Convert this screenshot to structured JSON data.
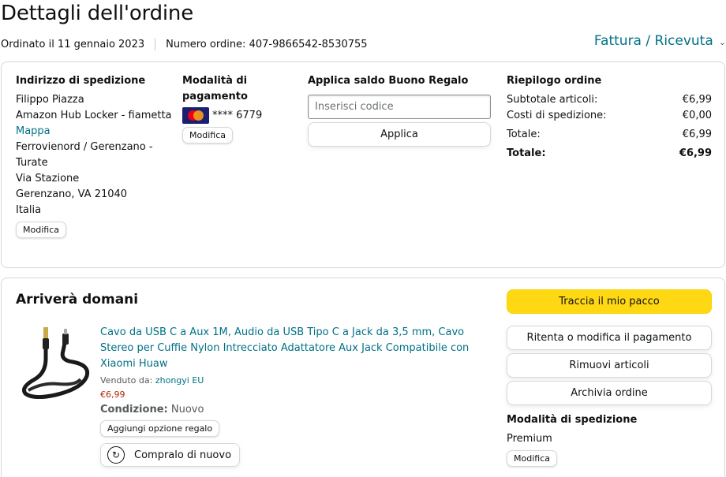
{
  "header": {
    "title": "Dettagli dell'ordine",
    "ordered_on": "Ordinato il 11 gennaio 2023",
    "order_number": "Numero ordine: 407-9866542-8530755",
    "invoice_link": "Fattura / Ricevuta"
  },
  "shipping": {
    "heading": "Indirizzo di spedizione",
    "name": "Filippo Piazza",
    "locker": "Amazon Hub Locker - fiametta",
    "map_link": "Mappa",
    "line1": "Ferrovienord / Gerenzano -",
    "line2": "Turate",
    "street": "Via Stazione",
    "city": "Gerenzano, VA 21040",
    "country": "Italia",
    "edit": "Modifica"
  },
  "payment": {
    "heading": "Modalità di pagamento",
    "card_brand": "mastercard-icon",
    "card_digits": "**** 6779",
    "edit": "Modifica"
  },
  "gift_card": {
    "heading": "Applica saldo Buono Regalo",
    "placeholder": "Inserisci codice",
    "apply": "Applica"
  },
  "summary": {
    "heading": "Riepilogo ordine",
    "rows": [
      {
        "label": "Subtotale articoli:",
        "value": "€6,99"
      },
      {
        "label": "Costi di spedizione:",
        "value": "€0,00"
      },
      {
        "label": "Totale:",
        "value": "€6,99"
      }
    ],
    "grand_total_label": "Totale:",
    "grand_total_value": "€6,99"
  },
  "shipment": {
    "status": "Arriverà domani",
    "product": {
      "title": "Cavo da USB C a Aux 1M, Audio da USB Tipo C a Jack da 3,5 mm, Cavo Stereo per Cuffie Nylon Intrecciato Adattatore Aux Jack Compatibile con Xiaomi Huaw",
      "sold_by_label": "Venduto da:",
      "seller": "zhongyi EU",
      "price": "€6,99",
      "condition_label": "Condizione:",
      "condition": "Nuovo",
      "gift_option": "Aggiungi opzione regalo",
      "buy_again": "Compralo di nuovo"
    },
    "actions": {
      "track": "Traccia il mio pacco",
      "retry_payment": "Ritenta o modifica il pagamento",
      "remove_items": "Rimuovi articoli",
      "archive": "Archivia ordine"
    },
    "shipping_mode": {
      "heading": "Modalità di spedizione",
      "value": "Premium",
      "edit": "Modifica"
    }
  },
  "colors": {
    "link": "#007185",
    "primary_button": "#ffd814",
    "price": "#b12704"
  }
}
